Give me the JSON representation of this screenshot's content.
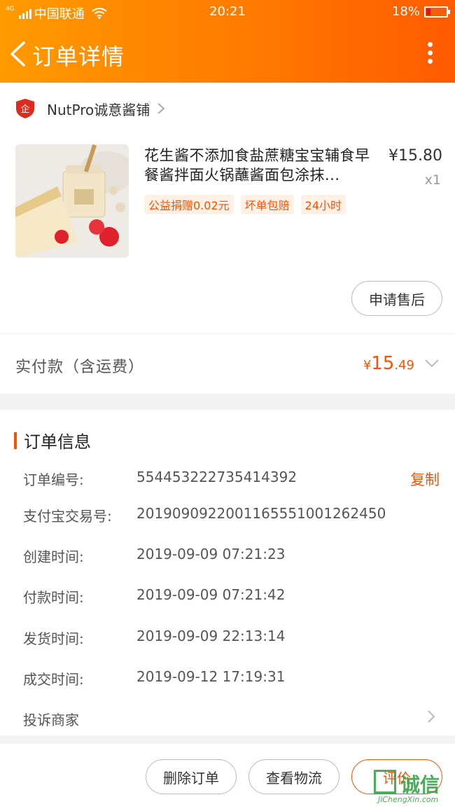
{
  "status_bar": {
    "network_type": "4G",
    "carrier": "中国联通",
    "time": "20:21",
    "battery": "18%",
    "battery_level": 0.18
  },
  "nav": {
    "title": "订单详情",
    "back_icon": "chevron-left-icon",
    "more_icon": "more-vertical-icon"
  },
  "shop": {
    "name": "NutPro诚意酱铺",
    "badge_icon": "enterprise-shield-icon",
    "badge_text": "企"
  },
  "product": {
    "title": "花生酱不添加食盐蔗糖宝宝辅食早餐酱拌面火锅蘸酱面包涂抹...",
    "price": "¥15.80",
    "quantity": "x1",
    "tags": [
      "公益捐赠0.02元",
      "坏单包赔",
      "24小时"
    ],
    "after_sale_button": "申请售后"
  },
  "payment": {
    "label": "实付款（含运费）",
    "currency": "¥",
    "amount_int": "15",
    "amount_dec": ".49"
  },
  "order_info": {
    "section_title": "订单信息",
    "copy_label": "复制",
    "rows": [
      {
        "label": "订单编号:",
        "value": "554453222735414392"
      },
      {
        "label": "支付宝交易号:",
        "value": "2019090922001165551001262450"
      },
      {
        "label": "创建时间:",
        "value": "2019-09-09 07:21:23"
      },
      {
        "label": "付款时间:",
        "value": "2019-09-09 07:21:42"
      },
      {
        "label": "发货时间:",
        "value": "2019-09-09 22:13:14"
      },
      {
        "label": "成交时间:",
        "value": "2019-09-12 17:19:31"
      }
    ],
    "complain_label": "投诉商家"
  },
  "actions": {
    "delete": "删除订单",
    "logistics": "查看物流",
    "review": "评价"
  },
  "watermark": {
    "text": "诚信",
    "sub": "JiChengXin.com"
  },
  "colors": {
    "accent": "#ff5000",
    "header_start": "#ff9a00",
    "header_end": "#ff5a00"
  }
}
